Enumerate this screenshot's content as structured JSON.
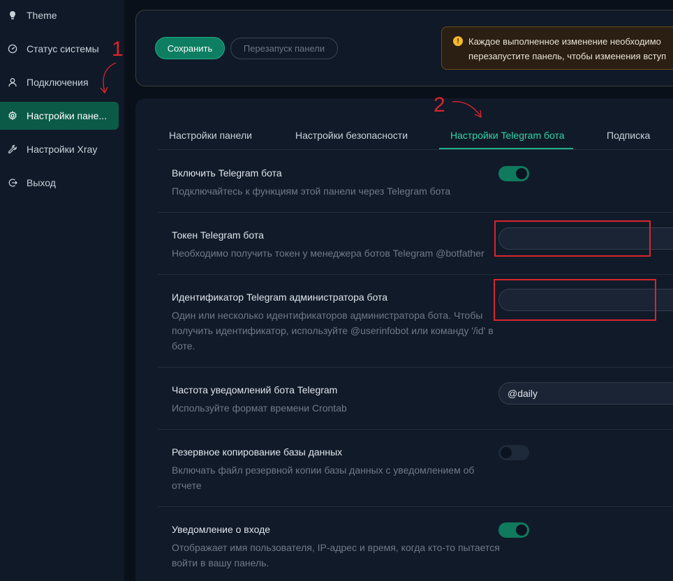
{
  "sidebar": {
    "items": [
      {
        "label": "Theme",
        "icon": "bulb-icon"
      },
      {
        "label": "Статус системы",
        "icon": "dashboard-icon"
      },
      {
        "label": "Подключения",
        "icon": "user-icon"
      },
      {
        "label": "Настройки пане...",
        "icon": "gear-icon",
        "active": true
      },
      {
        "label": "Настройки Xray",
        "icon": "wrench-icon"
      },
      {
        "label": "Выход",
        "icon": "logout-icon"
      }
    ]
  },
  "toolbar": {
    "save_label": "Сохранить",
    "restart_label": "Перезапуск панели",
    "alert_line1": "Каждое выполненное изменение необходимо",
    "alert_line2": "перезапустите панель, чтобы изменения вступ"
  },
  "tabs": [
    {
      "label": "Настройки панели"
    },
    {
      "label": "Настройки безопасности"
    },
    {
      "label": "Настройки Telegram бота",
      "active": true
    },
    {
      "label": "Подписка"
    }
  ],
  "settings": [
    {
      "title": "Включить Telegram бота",
      "desc": "Подключайтесь к функциям этой панели через Telegram бота",
      "control": "toggle",
      "state": "on"
    },
    {
      "title": "Токен Telegram бота",
      "desc": "Необходимо получить токен у менеджера ботов Telegram @botfather",
      "control": "input",
      "value": ""
    },
    {
      "title": "Идентификатор Telegram администратора бота",
      "desc": "Один или несколько идентификаторов администратора бота. Чтобы получить идентификатор, используйте @userinfobot или команду '/id' в боте.",
      "control": "input",
      "value": ""
    },
    {
      "title": "Частота уведомлений бота Telegram",
      "desc": "Используйте формат времени Crontab",
      "control": "input",
      "value": "@daily"
    },
    {
      "title": "Резервное копирование базы данных",
      "desc": "Включать файл резервной копии базы данных с уведомлением об отчете",
      "control": "toggle",
      "state": "off"
    },
    {
      "title": "Уведомление о входе",
      "desc": "Отображает имя пользователя, IP-адрес и время, когда кто-то пытается войти в вашу панель.",
      "control": "toggle",
      "state": "on"
    }
  ],
  "annotations": {
    "mark1": "1",
    "mark2": "2",
    "color": "#d8252d"
  },
  "colors": {
    "accent": "#1fae88",
    "active_nav": "#0b5a47",
    "background": "#0a1019",
    "card": "#111a28"
  }
}
